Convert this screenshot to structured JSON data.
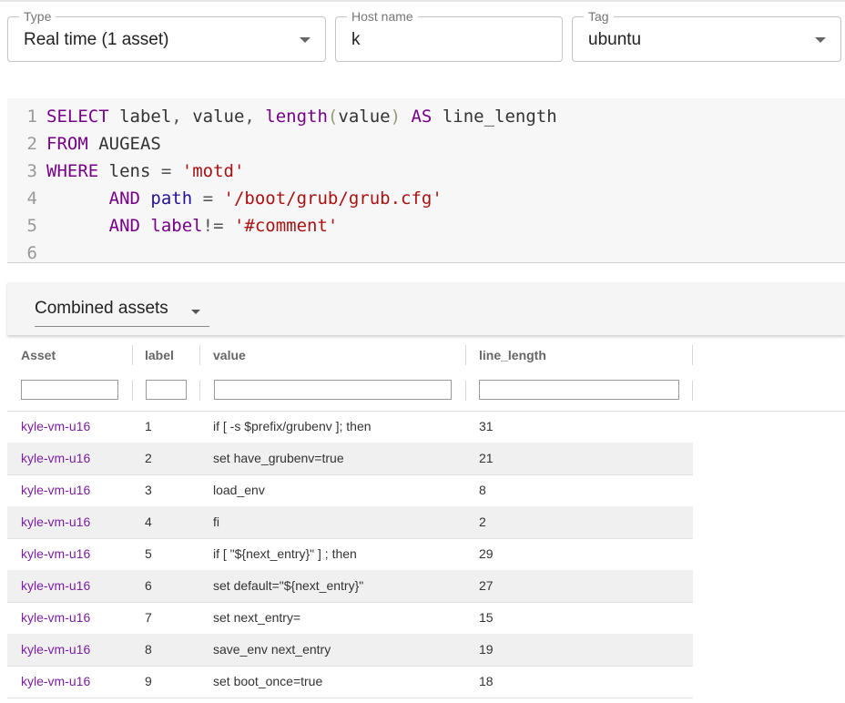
{
  "filters": {
    "type": {
      "label": "Type",
      "value": "Real time (1 asset)"
    },
    "host": {
      "label": "Host name",
      "value": "k"
    },
    "tag": {
      "label": "Tag",
      "value": "ubuntu"
    }
  },
  "editor": {
    "line_numbers": [
      "1",
      "2",
      "3",
      "4",
      "5",
      "6"
    ],
    "lines": [
      [
        {
          "t": "SELECT",
          "c": "kw"
        },
        {
          "t": " ",
          "c": "plain"
        },
        {
          "t": "label",
          "c": "plain"
        },
        {
          "t": ", ",
          "c": "op"
        },
        {
          "t": "value",
          "c": "plain"
        },
        {
          "t": ", ",
          "c": "op"
        },
        {
          "t": "length",
          "c": "kw"
        },
        {
          "t": "(",
          "c": "br"
        },
        {
          "t": "value",
          "c": "plain"
        },
        {
          "t": ")",
          "c": "br"
        },
        {
          "t": " ",
          "c": "plain"
        },
        {
          "t": "AS",
          "c": "kw"
        },
        {
          "t": " line_length",
          "c": "plain"
        }
      ],
      [
        {
          "t": "FROM",
          "c": "kw"
        },
        {
          "t": " AUGEAS",
          "c": "plain"
        }
      ],
      [
        {
          "t": "WHERE",
          "c": "kw"
        },
        {
          "t": " lens ",
          "c": "plain"
        },
        {
          "t": "=",
          "c": "op"
        },
        {
          "t": " ",
          "c": "plain"
        },
        {
          "t": "'motd'",
          "c": "str"
        }
      ],
      [
        {
          "t": "      ",
          "c": "plain"
        },
        {
          "t": "AND",
          "c": "kw"
        },
        {
          "t": " ",
          "c": "plain"
        },
        {
          "t": "path",
          "c": "fn"
        },
        {
          "t": " ",
          "c": "plain"
        },
        {
          "t": "=",
          "c": "op"
        },
        {
          "t": " ",
          "c": "plain"
        },
        {
          "t": "'/boot/grub/grub.cfg'",
          "c": "str"
        }
      ],
      [
        {
          "t": "      ",
          "c": "plain"
        },
        {
          "t": "AND",
          "c": "kw"
        },
        {
          "t": " ",
          "c": "plain"
        },
        {
          "t": "label",
          "c": "kw"
        },
        {
          "t": "!=",
          "c": "op"
        },
        {
          "t": " ",
          "c": "plain"
        },
        {
          "t": "'#comment'",
          "c": "str"
        }
      ],
      []
    ]
  },
  "results": {
    "asset_select": "Combined assets",
    "columns": [
      "Asset",
      "label",
      "value",
      "line_length"
    ],
    "rows": [
      [
        "kyle-vm-u16",
        "1",
        "if [ -s $prefix/grubenv ]; then",
        "31"
      ],
      [
        "kyle-vm-u16",
        "2",
        "set have_grubenv=true",
        "21"
      ],
      [
        "kyle-vm-u16",
        "3",
        "load_env",
        "8"
      ],
      [
        "kyle-vm-u16",
        "4",
        "fi",
        "2"
      ],
      [
        "kyle-vm-u16",
        "5",
        "if [ \"${next_entry}\" ] ; then",
        "29"
      ],
      [
        "kyle-vm-u16",
        "6",
        "set default=\"${next_entry}\"",
        "27"
      ],
      [
        "kyle-vm-u16",
        "7",
        "set next_entry=",
        "15"
      ],
      [
        "kyle-vm-u16",
        "8",
        "save_env next_entry",
        "19"
      ],
      [
        "kyle-vm-u16",
        "9",
        "set boot_once=true",
        "18"
      ]
    ]
  },
  "colors": {
    "keyword": "#770088",
    "string": "#aa1111",
    "asset_link": "#7b1fa2"
  }
}
